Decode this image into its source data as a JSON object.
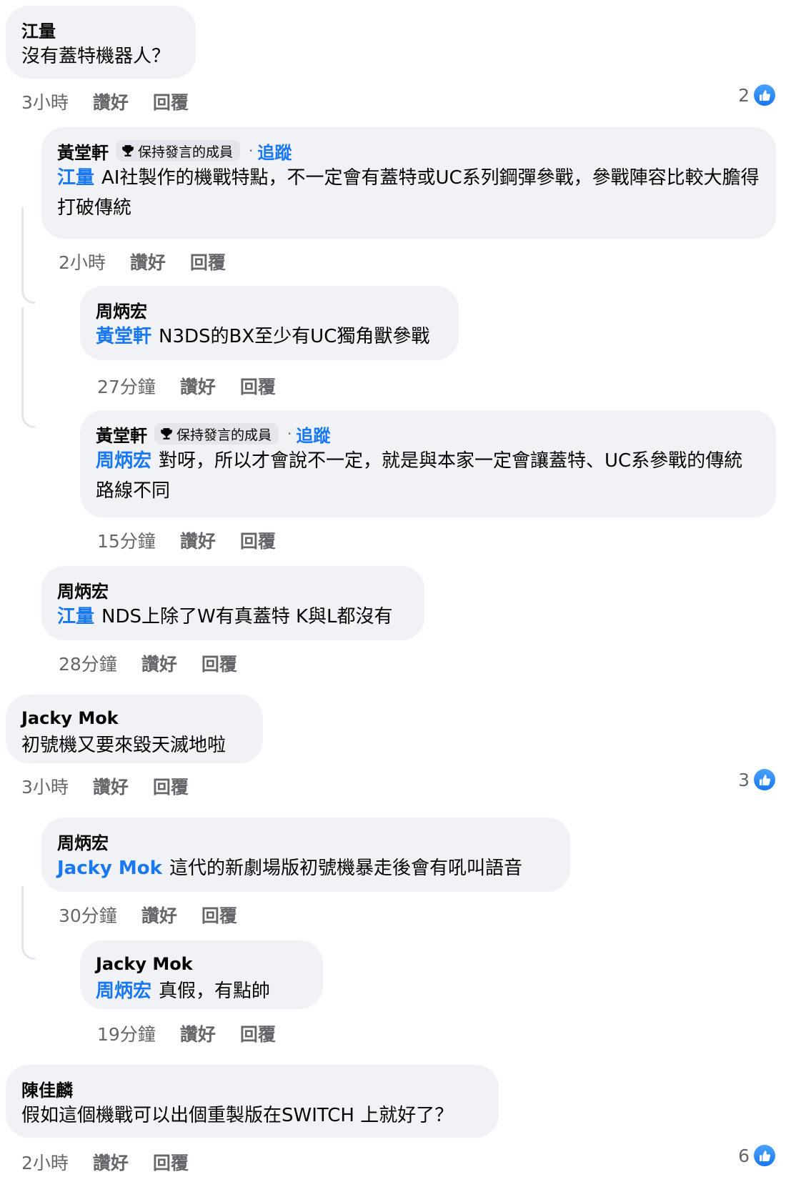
{
  "labels": {
    "like": "讚好",
    "reply": "回覆",
    "follow": "追蹤",
    "badge": "保持發言的成員"
  },
  "comments": [
    {
      "author": "江量",
      "text": "沒有蓋特機器人？",
      "time": "3小時",
      "reactions": "2"
    },
    {
      "author": "黃堂軒",
      "tag": "江量",
      "text": "AI社製作的機戰特點，不一定會有蓋特或UC系列鋼彈參戰，參戰陣容比較大膽得打破傳統",
      "time": "2小時"
    },
    {
      "author": "周炳宏",
      "tag": "黃堂軒",
      "text": "N3DS的BX至少有UC獨角獸參戰",
      "time": "27分鐘"
    },
    {
      "author": "黃堂軒",
      "tag": "周炳宏",
      "text": "對呀，所以才會說不一定，就是與本家一定會讓蓋特、UC系參戰的傳統路線不同",
      "time": "15分鐘"
    },
    {
      "author": "周炳宏",
      "tag": "江量",
      "text": "NDS上除了W有真蓋特 K與L都沒有",
      "time": "28分鐘"
    },
    {
      "author": "Jacky Mok",
      "text": "初號機又要來毀天滅地啦",
      "time": "3小時",
      "reactions": "3"
    },
    {
      "author": "周炳宏",
      "tag": "Jacky Mok",
      "text": "這代的新劇場版初號機暴走後會有吼叫語音",
      "time": "30分鐘"
    },
    {
      "author": "Jacky Mok",
      "tag": "周炳宏",
      "text": "真假，有點帥",
      "time": "19分鐘"
    },
    {
      "author": "陳佳麟",
      "text": "假如這個機戰可以出個重製版在SWITCH 上就好了？",
      "time": "2小時",
      "reactions": "6"
    }
  ]
}
